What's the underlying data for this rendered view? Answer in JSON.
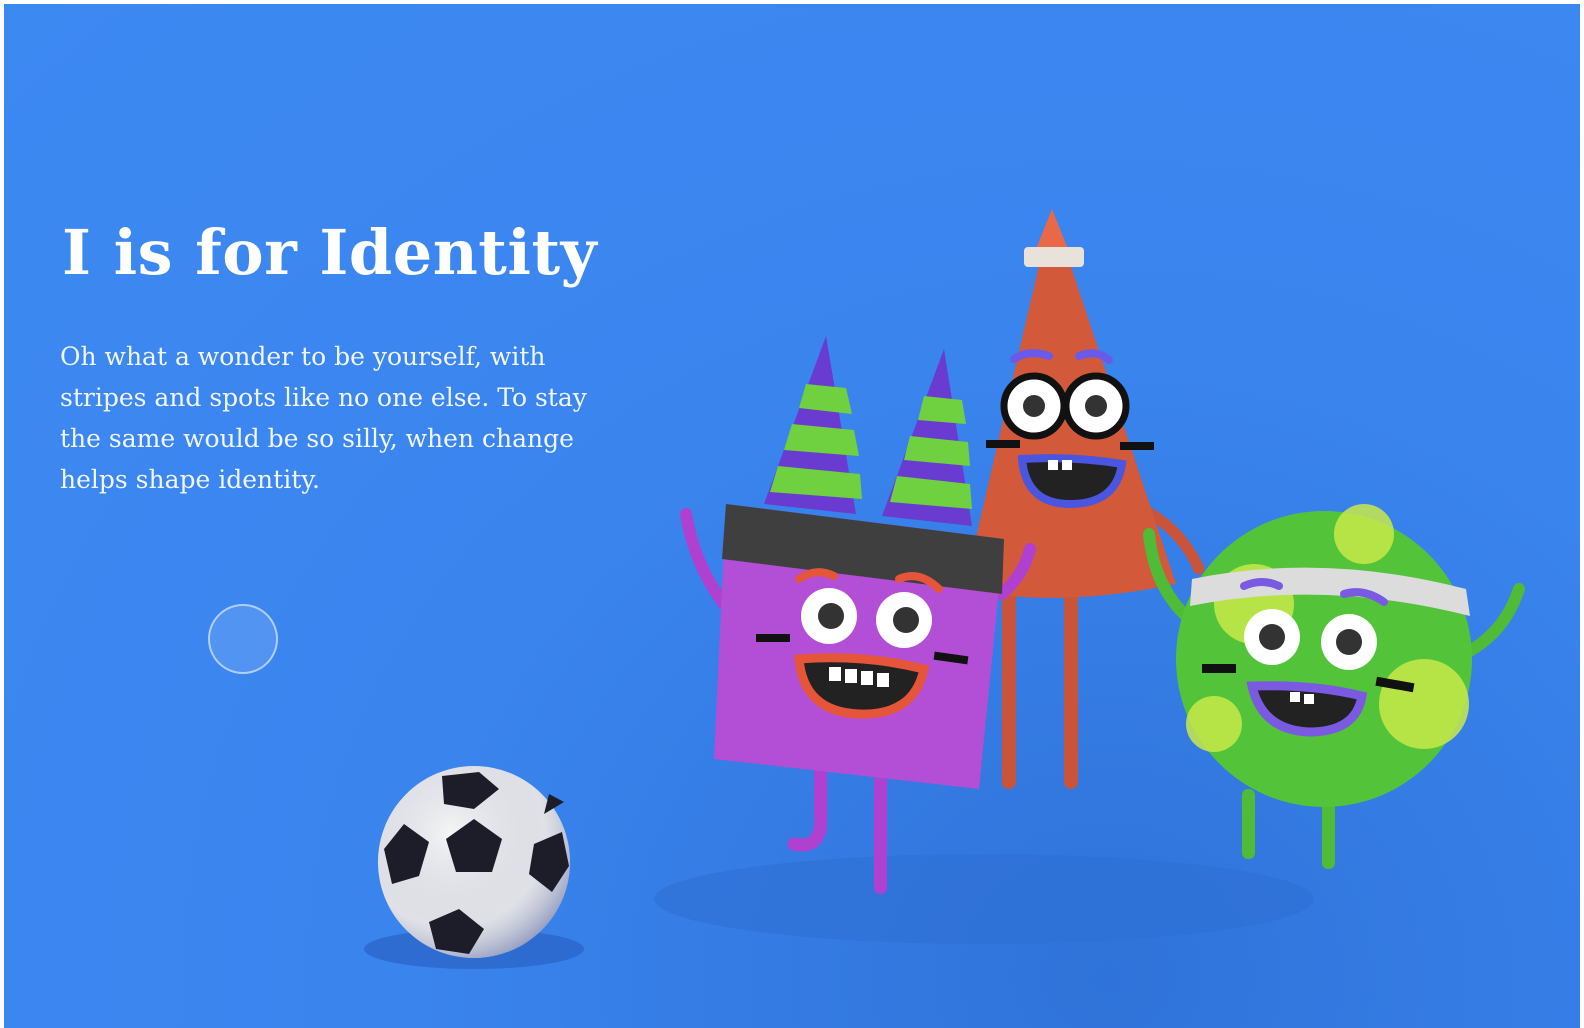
{
  "page": {
    "title": "I is for Identity",
    "body": "Oh what a wonder to be yourself, with stripes and spots like no one else. To stay the same would be so silly, when change helps shape identity.",
    "background_color": "#3d89f2"
  },
  "hotspot": {
    "icon": "circle-hotspot"
  },
  "illustration": {
    "characters": [
      "square-character",
      "cone-character",
      "ball-character"
    ],
    "colors": {
      "square": "#b24fd6",
      "cone": "#d25a3a",
      "ball": "#53c43a",
      "hat_stripe_purple": "#6a3bd0",
      "hat_stripe_green": "#6fd040"
    },
    "props": [
      "soccer-ball-icon",
      "party-hat-icon"
    ]
  }
}
